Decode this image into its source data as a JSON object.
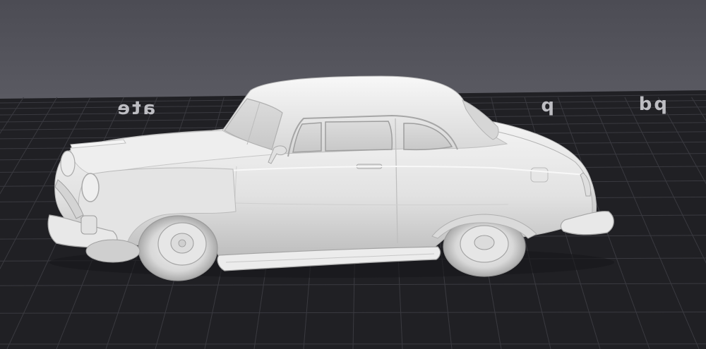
{
  "viewer": {
    "background_color": "#4f4f57",
    "bed_color": "#202024",
    "grid_color": "#3a3a40",
    "model_color": "#e6e6e6"
  },
  "bed": {
    "text_left": "ate",
    "text_mid": "p",
    "text_right": "pd"
  },
  "model": {
    "name_icon": "car-model"
  }
}
